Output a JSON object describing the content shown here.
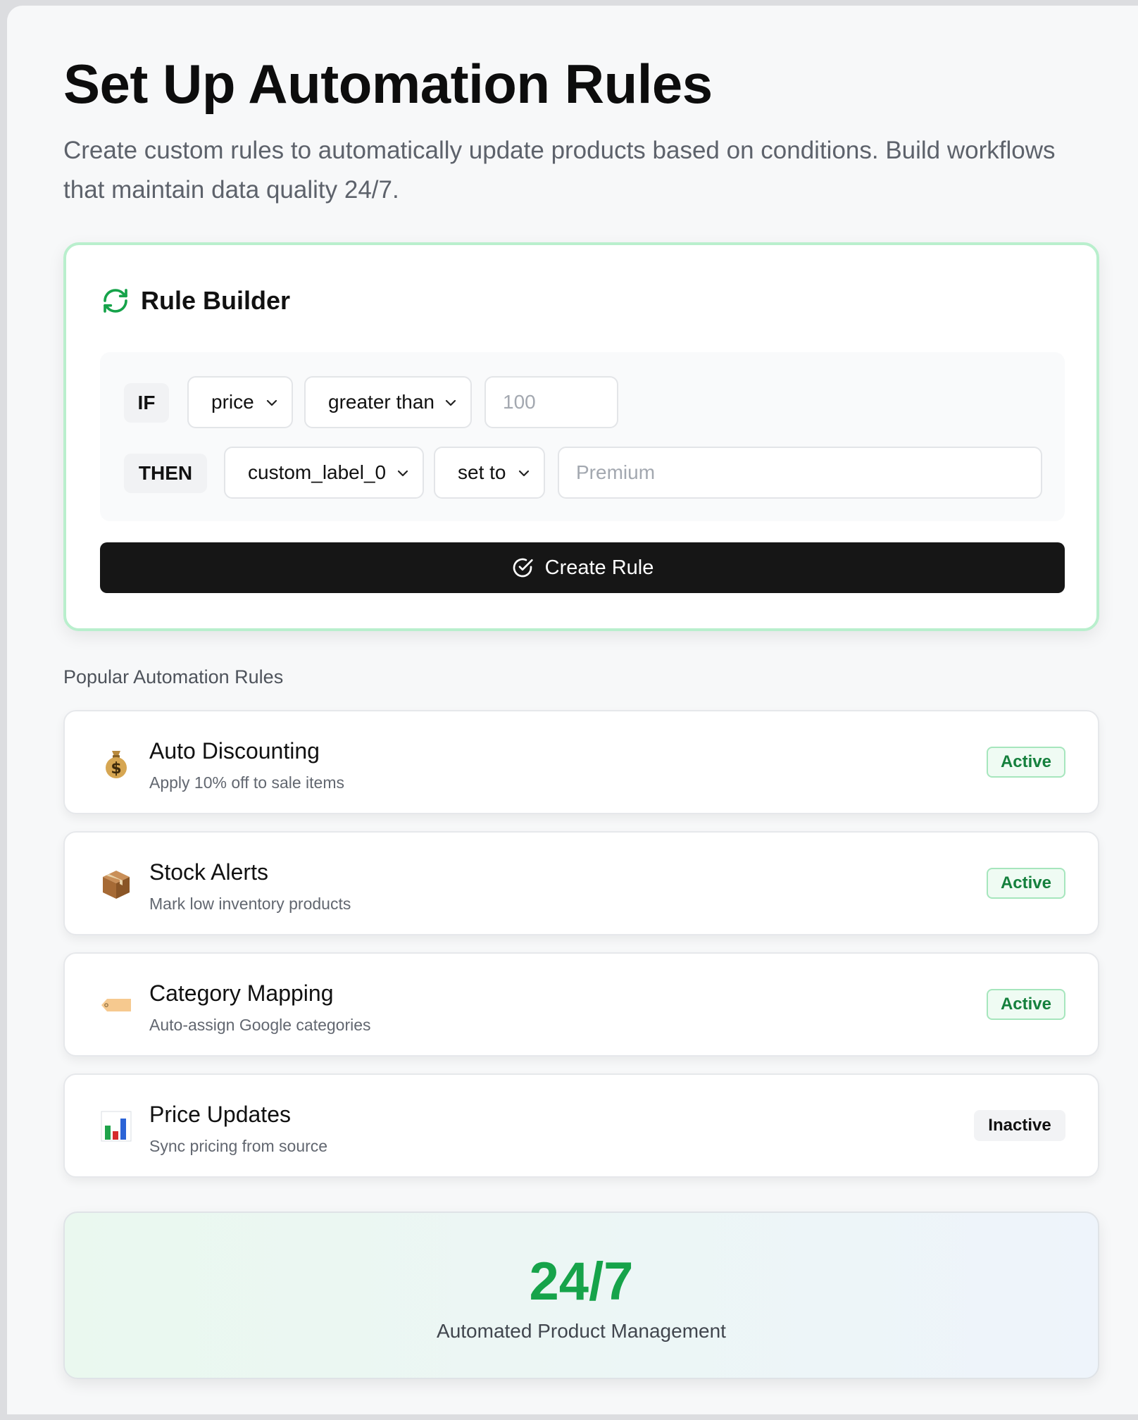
{
  "page": {
    "title": "Set Up Automation Rules",
    "description": "Create custom rules to automatically update products based on conditions. Build workflows that maintain data quality 24/7."
  },
  "rule_builder": {
    "title": "Rule Builder",
    "if_label": "IF",
    "then_label": "THEN",
    "condition_field": "price",
    "condition_operator": "greater than",
    "condition_value_placeholder": "100",
    "action_field": "custom_label_0",
    "action_operator": "set to",
    "action_value_placeholder": "Premium",
    "create_button": "Create Rule",
    "accent_color": "#16a34a"
  },
  "popular": {
    "heading": "Popular Automation Rules",
    "rules": [
      {
        "name": "Auto Discounting",
        "description": "Apply 10% off to sale items",
        "status": "Active",
        "icon": "money-bag-icon"
      },
      {
        "name": "Stock Alerts",
        "description": "Mark low inventory products",
        "status": "Active",
        "icon": "package-icon"
      },
      {
        "name": "Category Mapping",
        "description": "Auto-assign Google categories",
        "status": "Active",
        "icon": "tag-icon"
      },
      {
        "name": "Price Updates",
        "description": "Sync pricing from source",
        "status": "Inactive",
        "icon": "bar-chart-icon"
      }
    ]
  },
  "stat": {
    "value": "24/7",
    "label": "Automated Product Management",
    "color": "#16a34a"
  }
}
